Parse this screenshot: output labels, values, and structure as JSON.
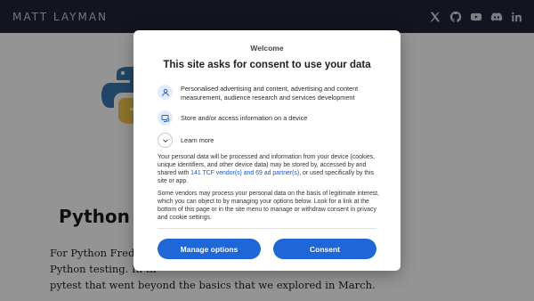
{
  "header": {
    "site_name": "MATT LAYMAN",
    "social_icons": [
      "x-icon",
      "github-icon",
      "youtube-icon",
      "discord-icon",
      "linkedin-icon"
    ]
  },
  "article": {
    "title": "Python T",
    "body_lines": [
      "For Python Frederic",
      "Python testing. In th",
      "pytest that went beyond the basics that we explored in March."
    ]
  },
  "consent": {
    "welcome": "Welcome",
    "title": "This site asks for consent to use your data",
    "purposes": [
      "Personalised advertising and content, advertising and content measurement, audience research and services development",
      "Store and/or access information on a device"
    ],
    "learn_more": "Learn more",
    "paragraph1_before": "Your personal data will be processed and information from your device (cookies, unique identifiers, and other device data) may be stored by, accessed by and shared with ",
    "paragraph1_link": "141 TCF vendor(s) and 69 ad partner(s)",
    "paragraph1_after": ", or used specifically by this site or app.",
    "paragraph2": "Some vendors may process your personal data on the basis of legitimate interest, which you can object to by managing your options below. Look for a link at the bottom of this page or in the site menu to manage or withdraw consent in privacy and cookie settings.",
    "manage_label": "Manage options",
    "consent_label": "Consent"
  },
  "colors": {
    "header_bg": "#242438",
    "button_bg": "#1f66d6",
    "link": "#1a56c9"
  }
}
